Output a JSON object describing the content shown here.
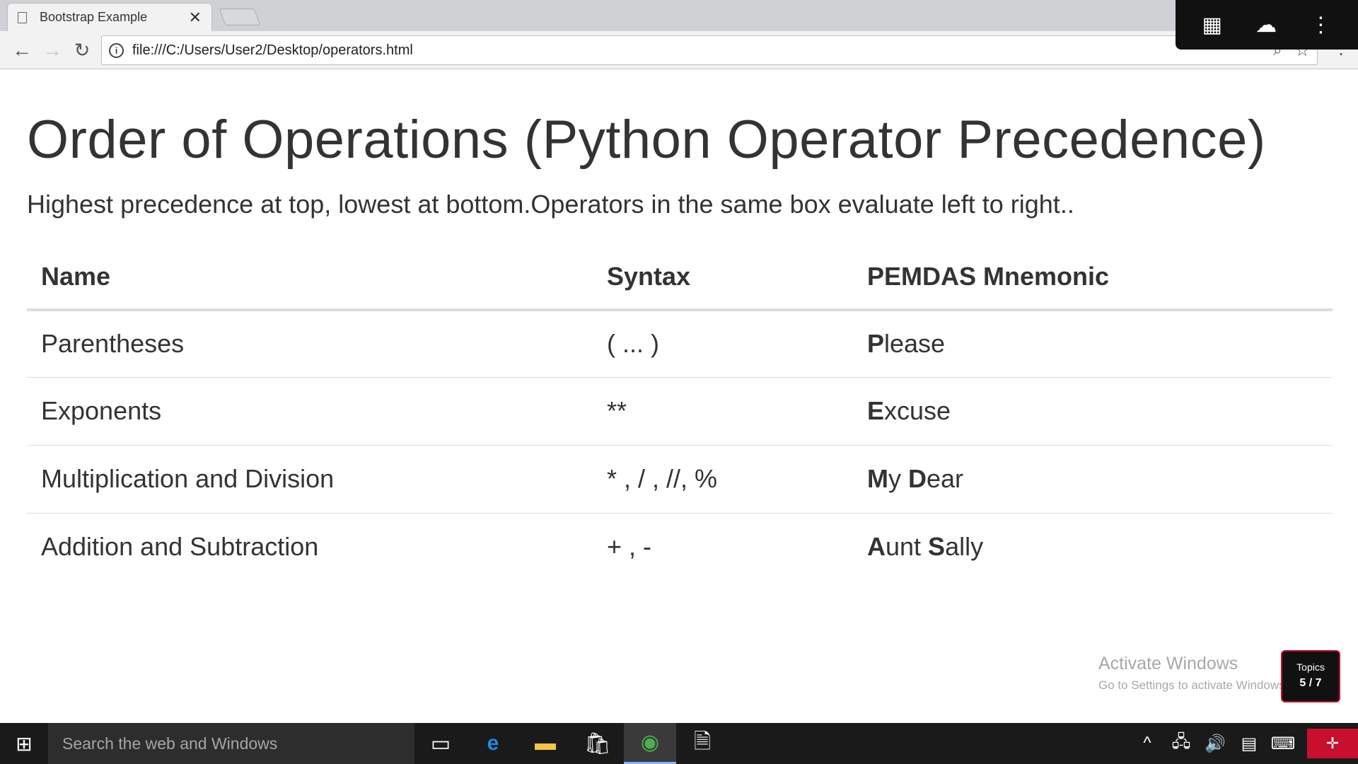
{
  "browser": {
    "tab_title": "Bootstrap Example",
    "url": "file:///C:/Users/User2/Desktop/operators.html"
  },
  "page": {
    "title": "Order of Operations (Python Operator Precedence)",
    "subtitle": "Highest precedence at top, lowest at bottom.Operators in the same box evaluate left to right..",
    "table": {
      "headers": [
        "Name",
        "Syntax",
        "PEMDAS Mnemonic"
      ],
      "rows": [
        {
          "name": "Parentheses",
          "syntax": "( ... )",
          "mnemonic": [
            {
              "b": "P",
              "r": "lease"
            }
          ]
        },
        {
          "name": "Exponents",
          "syntax": "**",
          "mnemonic": [
            {
              "b": "E",
              "r": "xcuse"
            }
          ]
        },
        {
          "name": "Multiplication and Division",
          "syntax": "* , / , //, %",
          "mnemonic": [
            {
              "b": "M",
              "r": "y "
            },
            {
              "b": "D",
              "r": "ear"
            }
          ]
        },
        {
          "name": "Addition and Subtraction",
          "syntax": "+ , -",
          "mnemonic": [
            {
              "b": "A",
              "r": "unt "
            },
            {
              "b": "S",
              "r": "ally"
            }
          ]
        }
      ]
    }
  },
  "watermark": {
    "title": "Activate Windows",
    "subtitle": "Go to Settings to activate Windows."
  },
  "topics": {
    "label": "Topics",
    "count": "5 / 7"
  },
  "taskbar": {
    "search_placeholder": "Search the web and Windows"
  }
}
